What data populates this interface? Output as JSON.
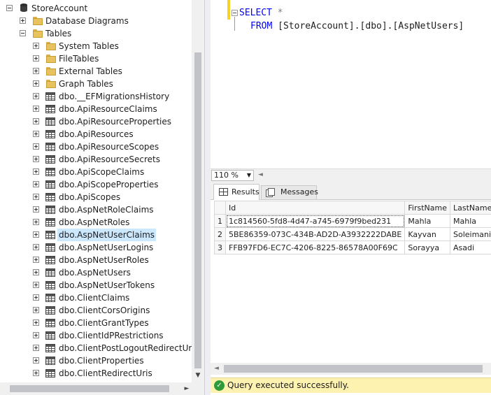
{
  "object_explorer": {
    "root": "StoreAccount",
    "database_diagrams": "Database Diagrams",
    "tables_folder": "Tables",
    "folders": [
      "System Tables",
      "FileTables",
      "External Tables",
      "Graph Tables"
    ],
    "tables": [
      "dbo.__EFMigrationsHistory",
      "dbo.ApiResourceClaims",
      "dbo.ApiResourceProperties",
      "dbo.ApiResources",
      "dbo.ApiResourceScopes",
      "dbo.ApiResourceSecrets",
      "dbo.ApiScopeClaims",
      "dbo.ApiScopeProperties",
      "dbo.ApiScopes",
      "dbo.AspNetRoleClaims",
      "dbo.AspNetRoles",
      "dbo.AspNetUserClaims",
      "dbo.AspNetUserLogins",
      "dbo.AspNetUserRoles",
      "dbo.AspNetUsers",
      "dbo.AspNetUserTokens",
      "dbo.ClientClaims",
      "dbo.ClientCorsOrigins",
      "dbo.ClientGrantTypes",
      "dbo.ClientIdPRestrictions",
      "dbo.ClientPostLogoutRedirectUris",
      "dbo.ClientProperties",
      "dbo.ClientRedirectUris"
    ],
    "selected_table": "dbo.AspNetUserClaims"
  },
  "editor": {
    "line1_kw": "SELECT",
    "line1_rest": " *",
    "line2_kw": "FROM",
    "line2_obj": " [StoreAccount].[dbo].[AspNetUsers]"
  },
  "zoom": {
    "value": "110 %"
  },
  "tabs": {
    "results": "Results",
    "messages": "Messages"
  },
  "grid": {
    "columns": [
      "Id",
      "FirstName",
      "LastName"
    ],
    "rows": [
      [
        "1",
        "1c814560-5fd8-4d47-a745-6979f9bed231",
        "Mahla",
        "Mahla"
      ],
      [
        "2",
        "5BE86359-073C-434B-AD2D-A3932222DABE",
        "Kayvan",
        "Soleimani"
      ],
      [
        "3",
        "FFB97FD6-EC7C-4206-8225-86578A00F69C",
        "Sorayya",
        "Asadi"
      ]
    ]
  },
  "status": {
    "message": "Query executed successfully."
  },
  "colors": {
    "keyword": "#0000ff",
    "status_bg": "#fdf2b0",
    "success": "#2e9b3a",
    "selection": "#cce8ff"
  }
}
